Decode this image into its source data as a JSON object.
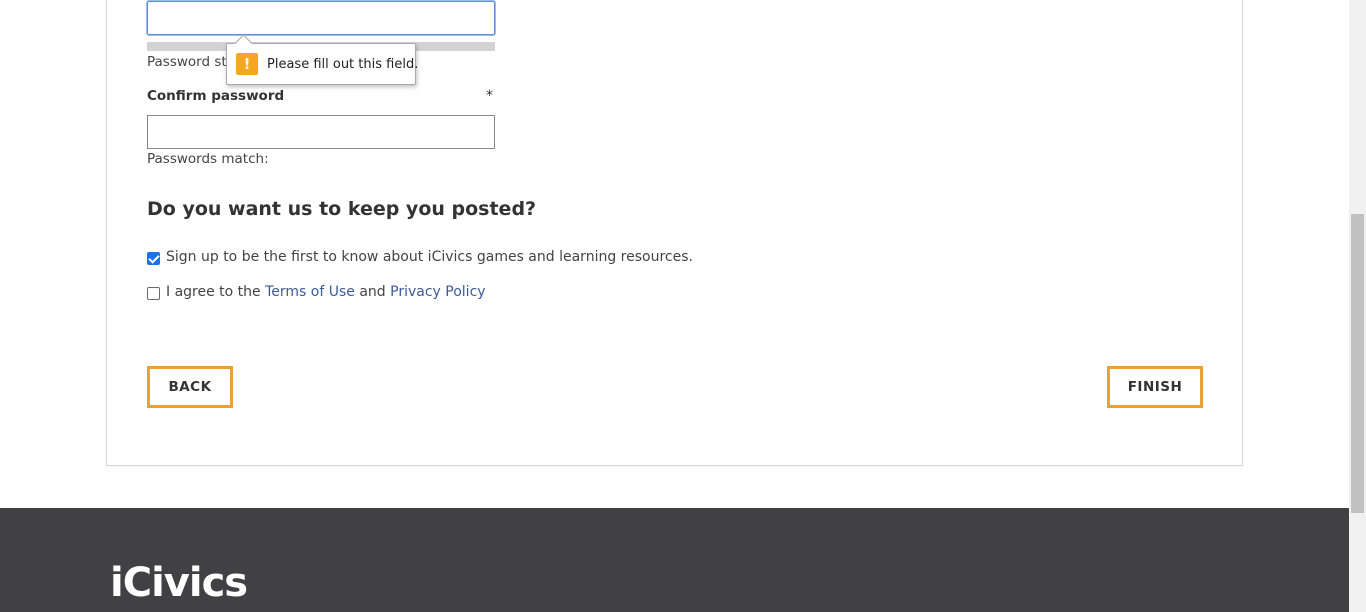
{
  "form": {
    "password_strength_label": "Password strength:",
    "tooltip_text": "Please fill out this field.",
    "tooltip_icon": "warning-icon",
    "confirm_label": "Confirm password",
    "required_marker": "*",
    "passwords_match_label": "Passwords match:"
  },
  "newsletter": {
    "heading": "Do you want us to keep you posted?",
    "signup_label": "Sign up to be the first to know about iCivics games and learning resources.",
    "signup_checked": true,
    "agree_prefix": "I agree to the",
    "terms_link": "Terms of Use",
    "agree_and": "and",
    "privacy_link": "Privacy Policy",
    "agree_checked": false
  },
  "buttons": {
    "back_label": "BACK",
    "finish_label": "FINISH"
  },
  "footer": {
    "logo_text": "iCivics"
  },
  "colors": {
    "accent": "#f0a030",
    "link": "#3d5a99",
    "footer_bg": "#414143",
    "warning": "#f5a623"
  }
}
